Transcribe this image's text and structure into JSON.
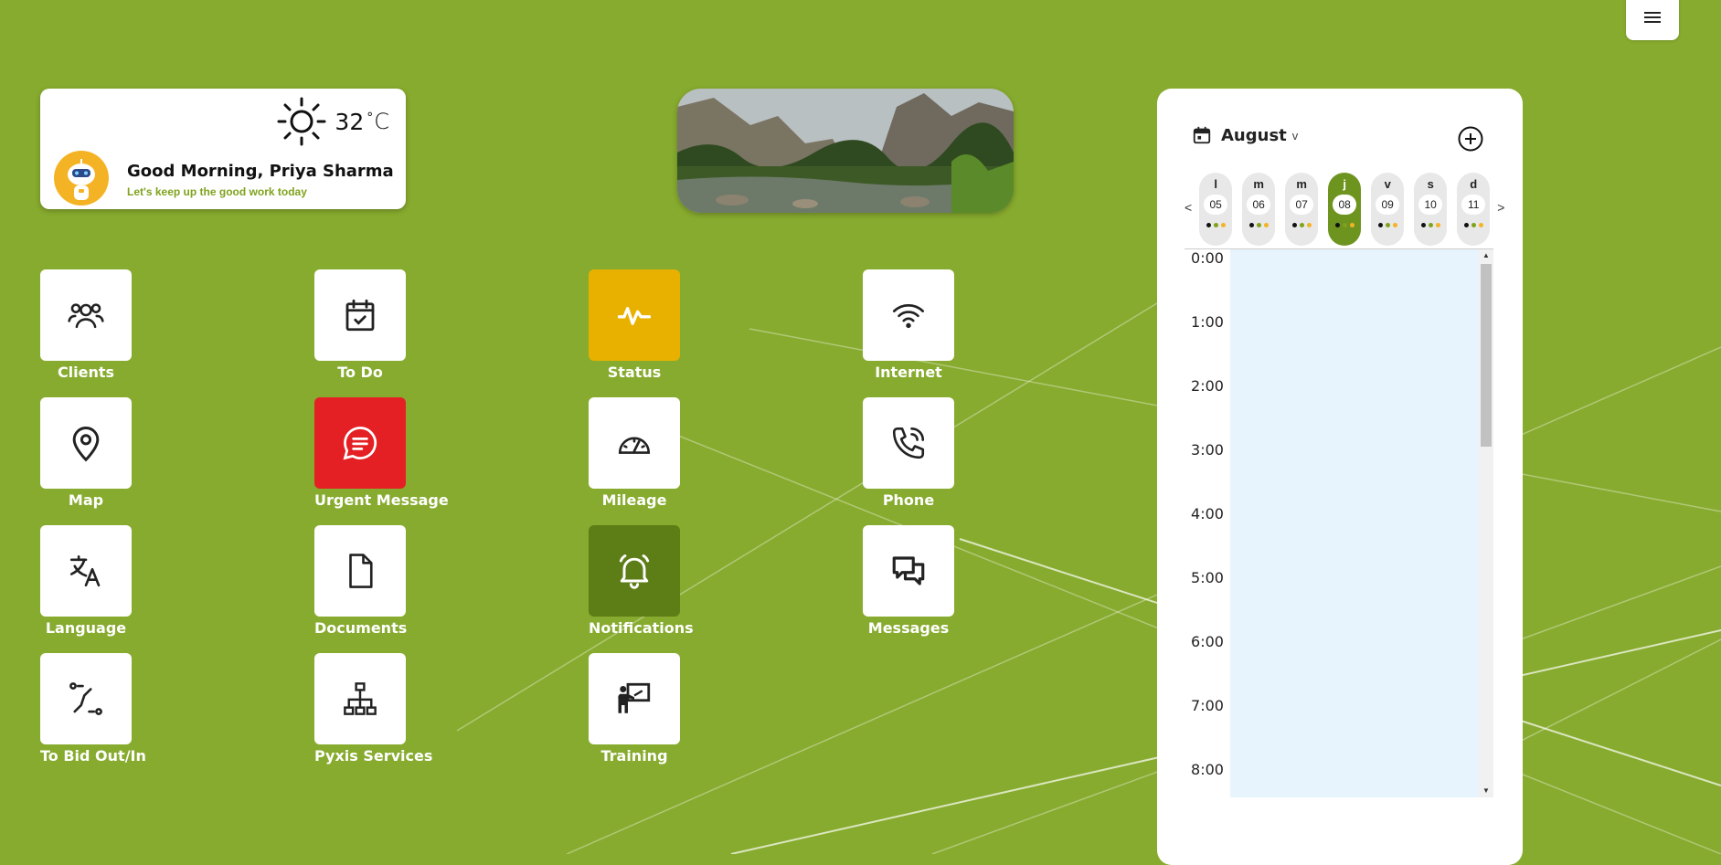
{
  "weather": {
    "temp": "32",
    "deg": "°",
    "unit": "C",
    "icon": "sun-icon"
  },
  "greeting": {
    "title": "Good Morning, Priya Sharma",
    "subtitle": "Let's keep up the good work today"
  },
  "tiles": [
    {
      "label": "Clients",
      "icon": "users-icon"
    },
    {
      "label": "To Do",
      "icon": "calendar-check-icon"
    },
    {
      "label": "Status",
      "icon": "activity-icon",
      "color": "#e8b100"
    },
    {
      "label": "Internet",
      "icon": "wifi-icon"
    },
    {
      "label": "Map",
      "icon": "map-pin-icon"
    },
    {
      "label": "Urgent Message",
      "icon": "message-icon",
      "color": "#e52024"
    },
    {
      "label": "Mileage",
      "icon": "gauge-icon"
    },
    {
      "label": "Phone",
      "icon": "phone-icon"
    },
    {
      "label": "Language",
      "icon": "translate-icon"
    },
    {
      "label": "Documents",
      "icon": "document-icon"
    },
    {
      "label": "Notifications",
      "icon": "bell-icon",
      "color": "#5d7d17"
    },
    {
      "label": "Messages",
      "icon": "chat-icon"
    },
    {
      "label": "To Bid Out/In",
      "icon": "route-icon"
    },
    {
      "label": "Pyxis Services",
      "icon": "sitemap-icon"
    },
    {
      "label": "Training",
      "icon": "presentation-icon"
    }
  ],
  "calendar": {
    "month": "August",
    "caret": "v",
    "prev": "<",
    "next": ">",
    "days": [
      {
        "letter": "l",
        "num": "05"
      },
      {
        "letter": "m",
        "num": "06"
      },
      {
        "letter": "m",
        "num": "07"
      },
      {
        "letter": "j",
        "num": "08",
        "active": true
      },
      {
        "letter": "v",
        "num": "09"
      },
      {
        "letter": "s",
        "num": "10"
      },
      {
        "letter": "d",
        "num": "11"
      }
    ],
    "dot_colors": [
      "#111111",
      "#7fa21d",
      "#f4b324"
    ],
    "hours": [
      "0:00",
      "1:00",
      "2:00",
      "3:00",
      "4:00",
      "5:00",
      "6:00",
      "7:00",
      "8:00"
    ]
  },
  "colors": {
    "background": "#87ab2e",
    "accent": "#6e9420"
  }
}
